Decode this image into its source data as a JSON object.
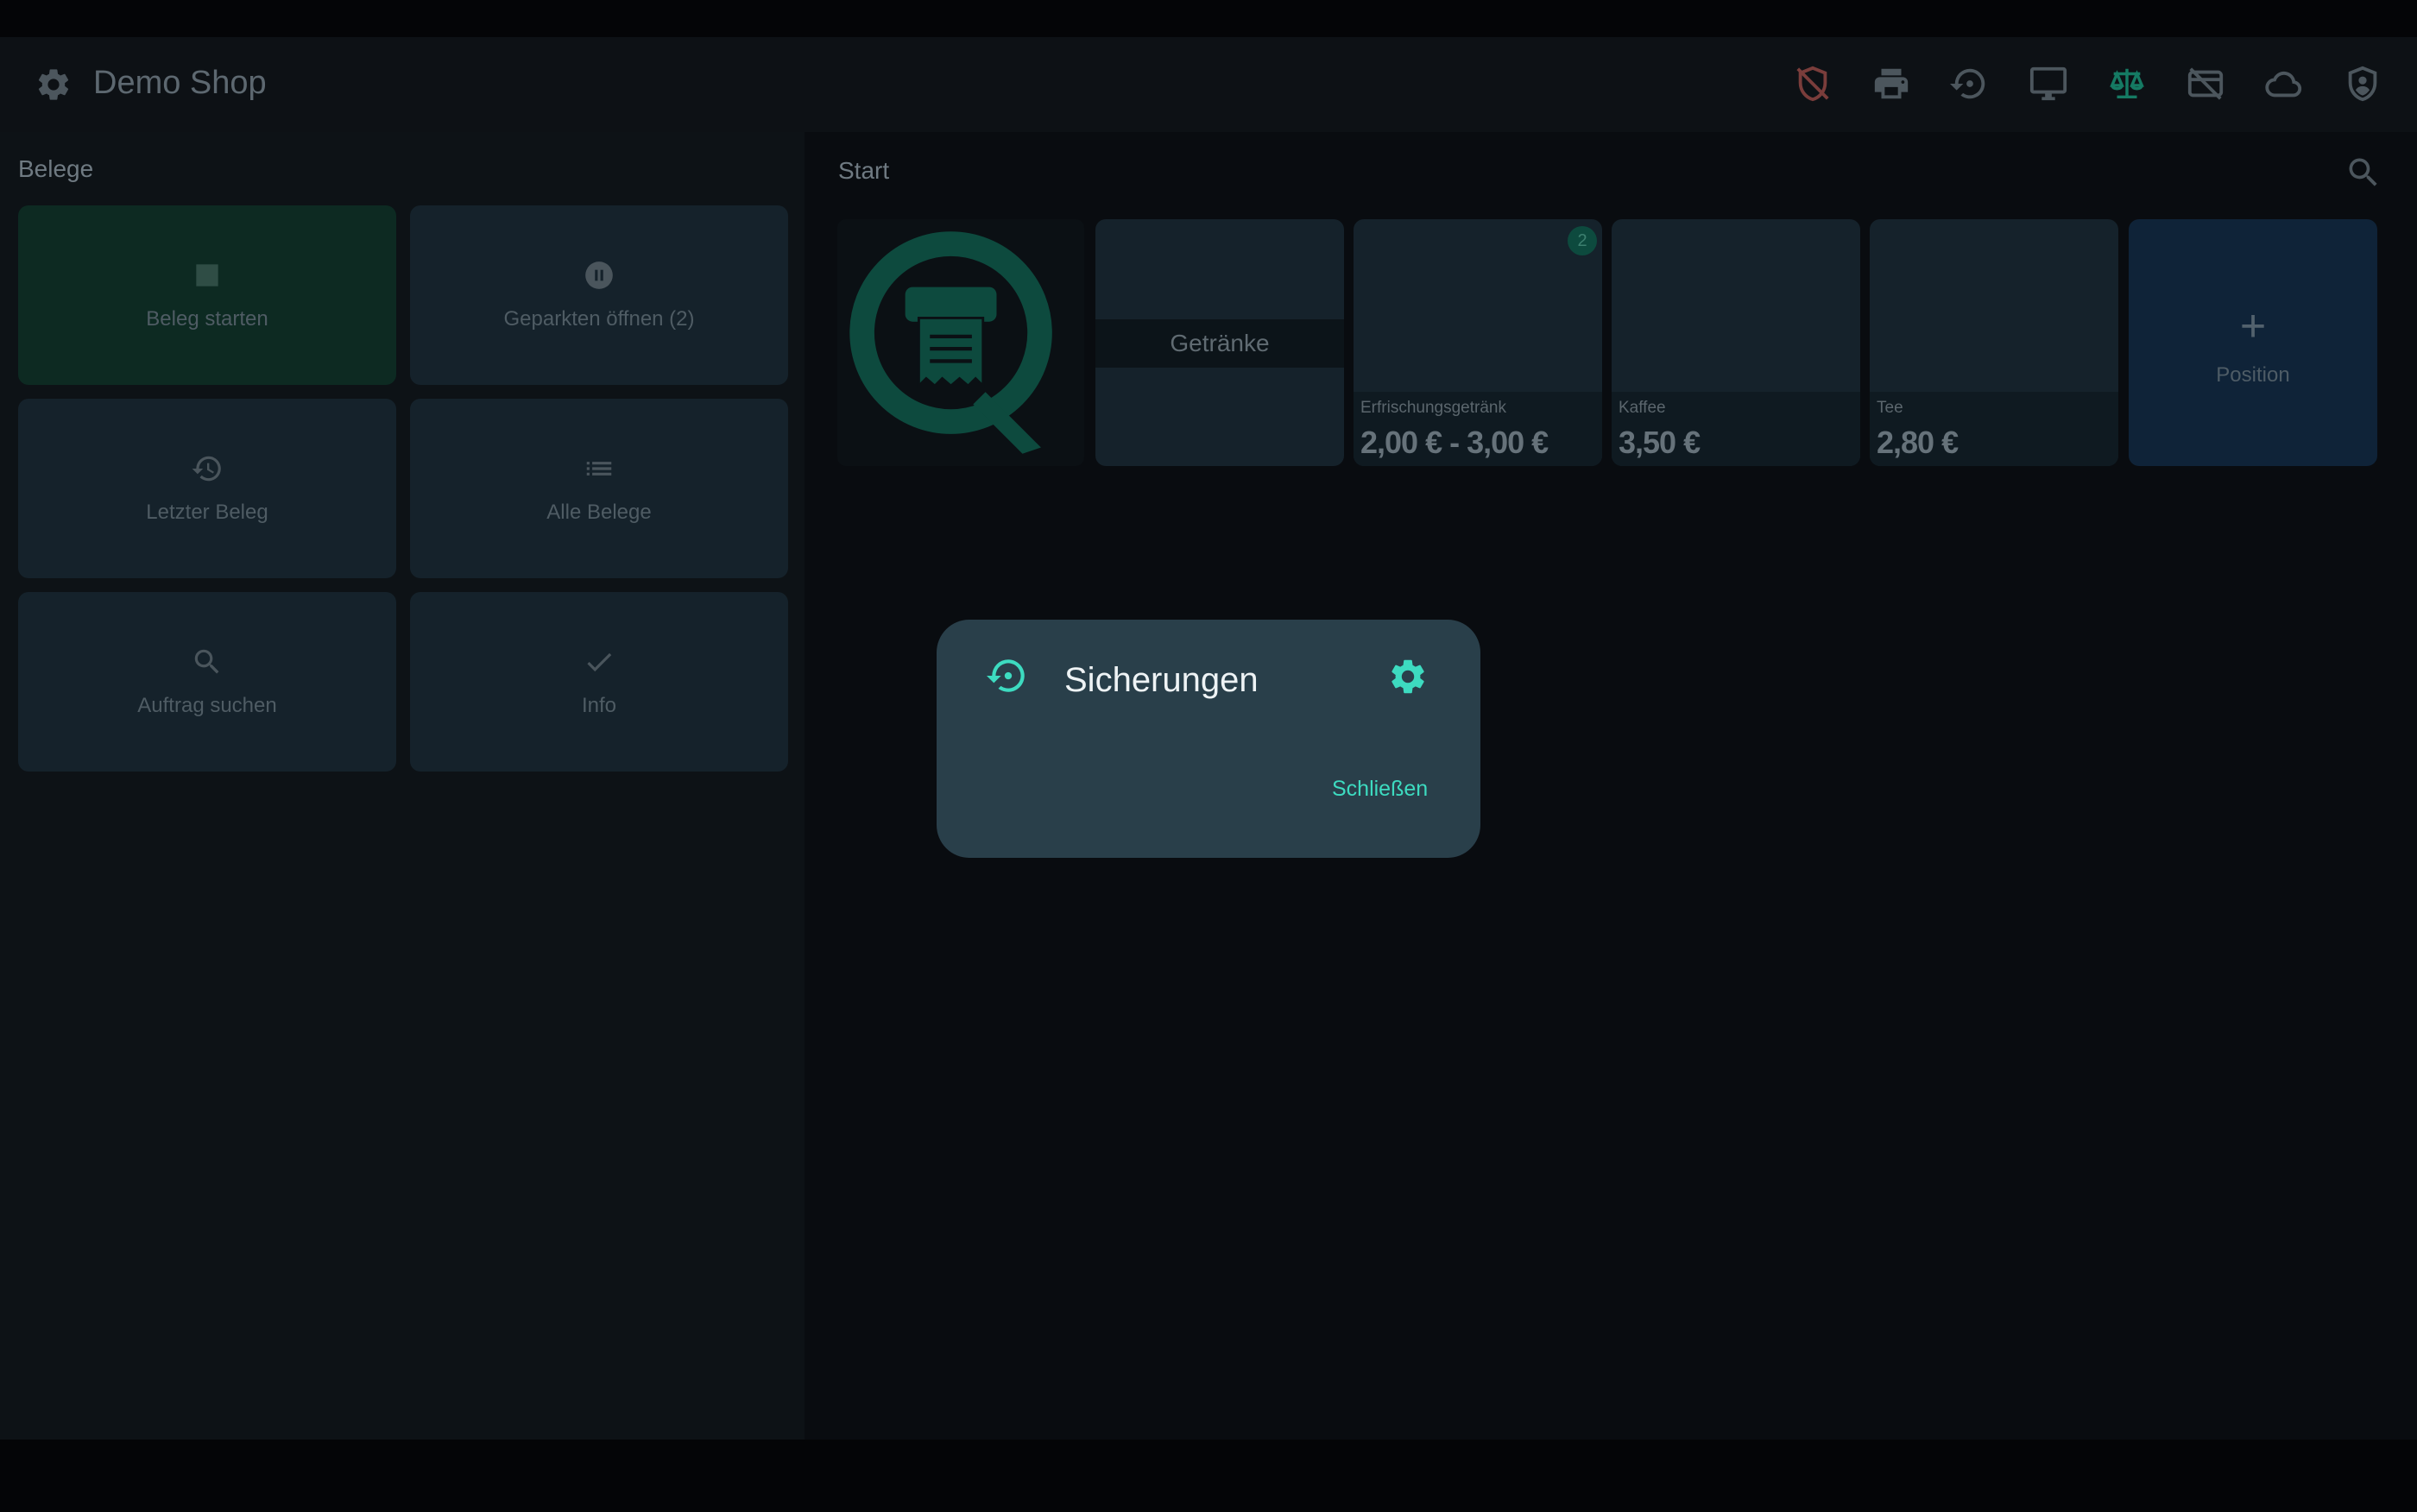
{
  "app": {
    "title": "Demo Shop"
  },
  "toolbar_icons": [
    "shield-off-icon",
    "printer-icon",
    "backup-restore-icon",
    "monitor-icon",
    "scale-icon",
    "card-off-icon",
    "cloud-icon",
    "shield-account-icon"
  ],
  "left_panel": {
    "title": "Belege",
    "tiles": [
      {
        "label": "Beleg starten",
        "icon": "stop-square-icon"
      },
      {
        "label": "Geparkten öffnen (2)",
        "icon": "pause-circle-icon"
      },
      {
        "label": "Letzter Beleg",
        "icon": "history-icon"
      },
      {
        "label": "Alle Belege",
        "icon": "list-icon"
      },
      {
        "label": "Auftrag suchen",
        "icon": "search-icon"
      },
      {
        "label": "Info",
        "icon": "check-icon"
      }
    ]
  },
  "right_panel": {
    "title": "Start",
    "category": {
      "label": "Getränke"
    },
    "products": [
      {
        "name": "Erfrischungsgetränk",
        "price": "2,00 € - 3,00 €",
        "badge": "2"
      },
      {
        "name": "Kaffee",
        "price": "3,50 €"
      },
      {
        "name": "Tee",
        "price": "2,80 €"
      }
    ],
    "add_button": {
      "label": "Position"
    }
  },
  "dialog": {
    "title": "Sicherungen",
    "close_label": "Schließen"
  },
  "colors": {
    "accent": "#3ddbc0",
    "dialog_bg": "#293f4a",
    "tile_bg": "#15222b",
    "background": "#0a0c0f"
  }
}
